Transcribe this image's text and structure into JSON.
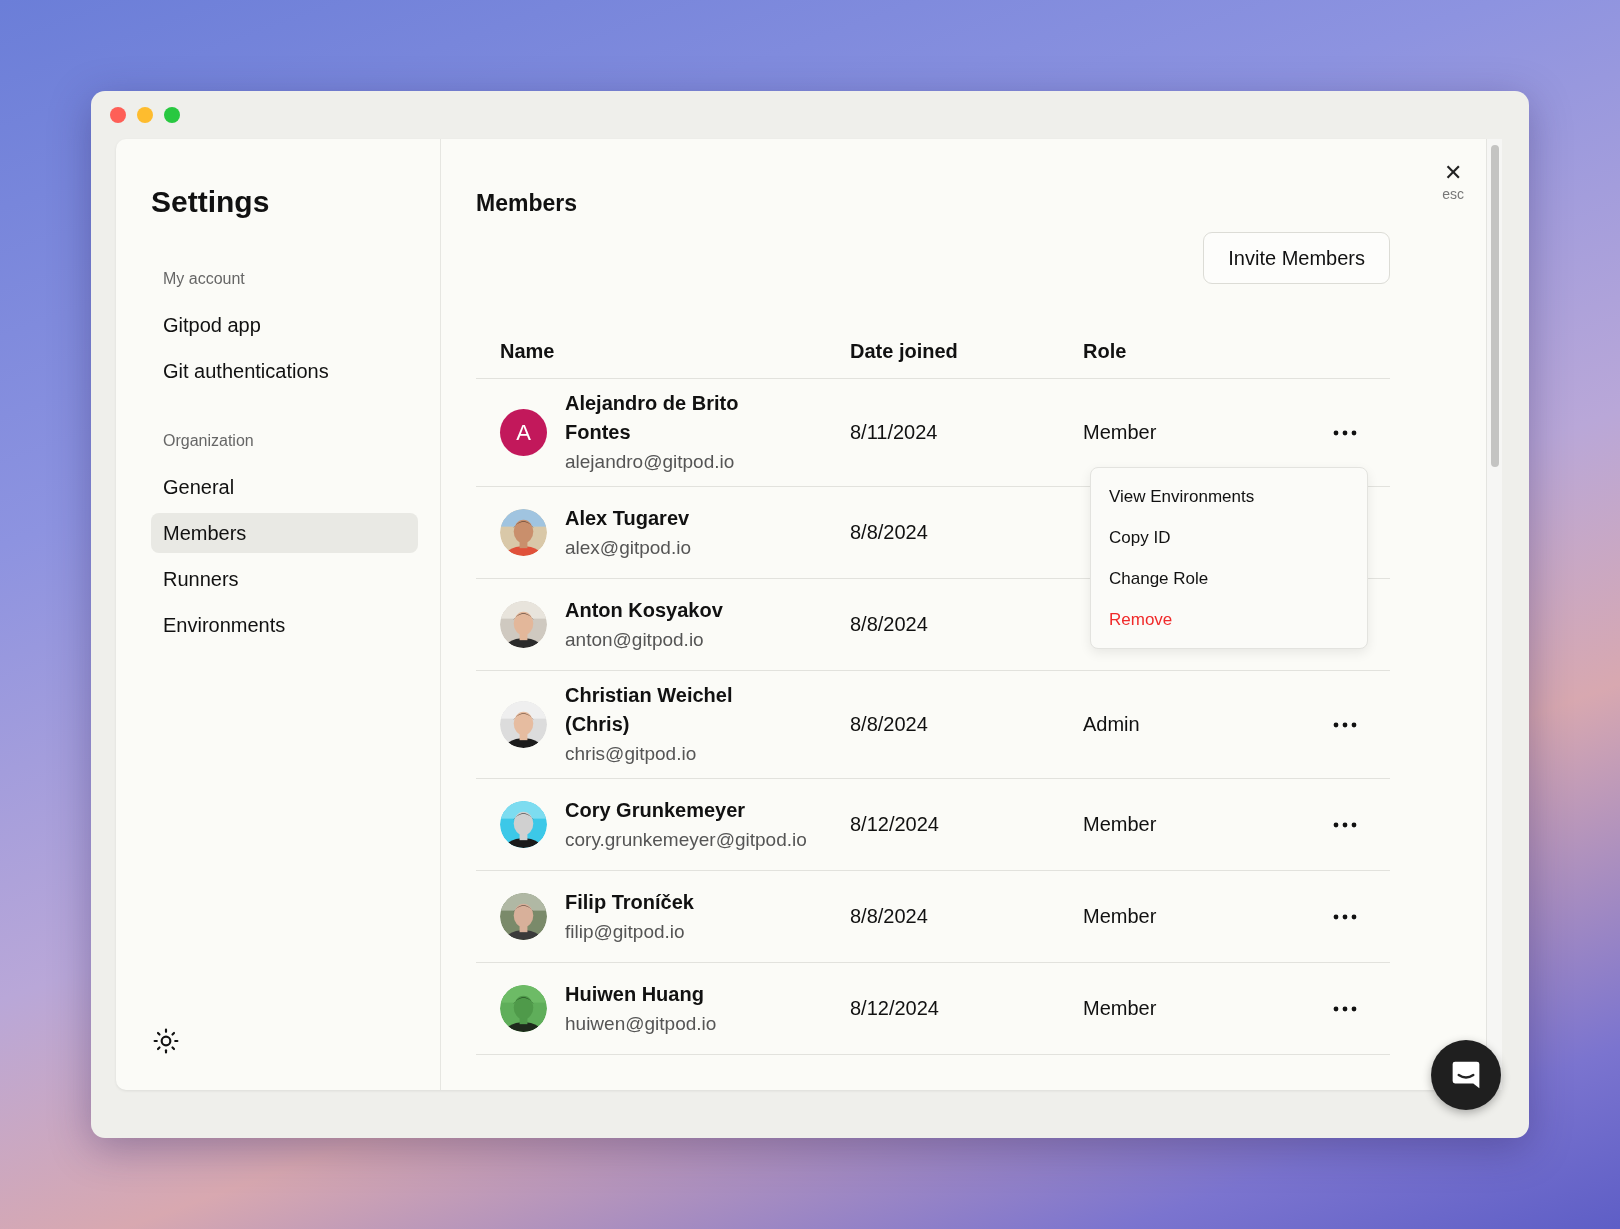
{
  "sidebar": {
    "title": "Settings",
    "sections": [
      {
        "heading": "My account",
        "items": [
          {
            "label": "Gitpod app",
            "selected": false
          },
          {
            "label": "Git authentications",
            "selected": false
          }
        ]
      },
      {
        "heading": "Organization",
        "items": [
          {
            "label": "General",
            "selected": false
          },
          {
            "label": "Members",
            "selected": true
          },
          {
            "label": "Runners",
            "selected": false
          },
          {
            "label": "Environments",
            "selected": false
          }
        ]
      }
    ]
  },
  "close": {
    "glyph": "✕",
    "hint": "esc"
  },
  "page": {
    "title": "Members",
    "invite_button": "Invite Members"
  },
  "table": {
    "columns": [
      "Name",
      "Date joined",
      "Role"
    ],
    "rows": [
      {
        "avatar": {
          "kind": "initial",
          "letter": "A",
          "color": "#c2185b"
        },
        "name": "Alejandro de Brito Fontes",
        "email": "alejandro@gitpod.io",
        "date": "8/11/2024",
        "role": "Member",
        "menu": {
          "items": [
            {
              "label": "View Environments",
              "kind": "normal"
            },
            {
              "label": "Copy ID",
              "kind": "normal"
            },
            {
              "label": "Change Role",
              "kind": "normal"
            },
            {
              "label": "Remove",
              "kind": "danger"
            }
          ]
        }
      },
      {
        "name": "Alex Tugarev",
        "email": "alex@gitpod.io",
        "date": "8/8/2024"
      },
      {
        "name": "Anton Kosyakov",
        "email": "anton@gitpod.io",
        "date": "8/8/2024"
      },
      {
        "name": "Christian Weichel (Chris)",
        "email": "chris@gitpod.io",
        "date": "8/8/2024",
        "role": "Admin"
      },
      {
        "name": "Cory Grunkemeyer",
        "email": "cory.grunkemeyer@gitpod.io",
        "date": "8/12/2024",
        "role": "Member"
      },
      {
        "name": "Filip Troníček",
        "email": "filip@gitpod.io",
        "date": "8/8/2024",
        "role": "Member"
      },
      {
        "name": "Huiwen Huang",
        "email": "huiwen@gitpod.io",
        "date": "8/12/2024",
        "role": "Member"
      }
    ]
  }
}
